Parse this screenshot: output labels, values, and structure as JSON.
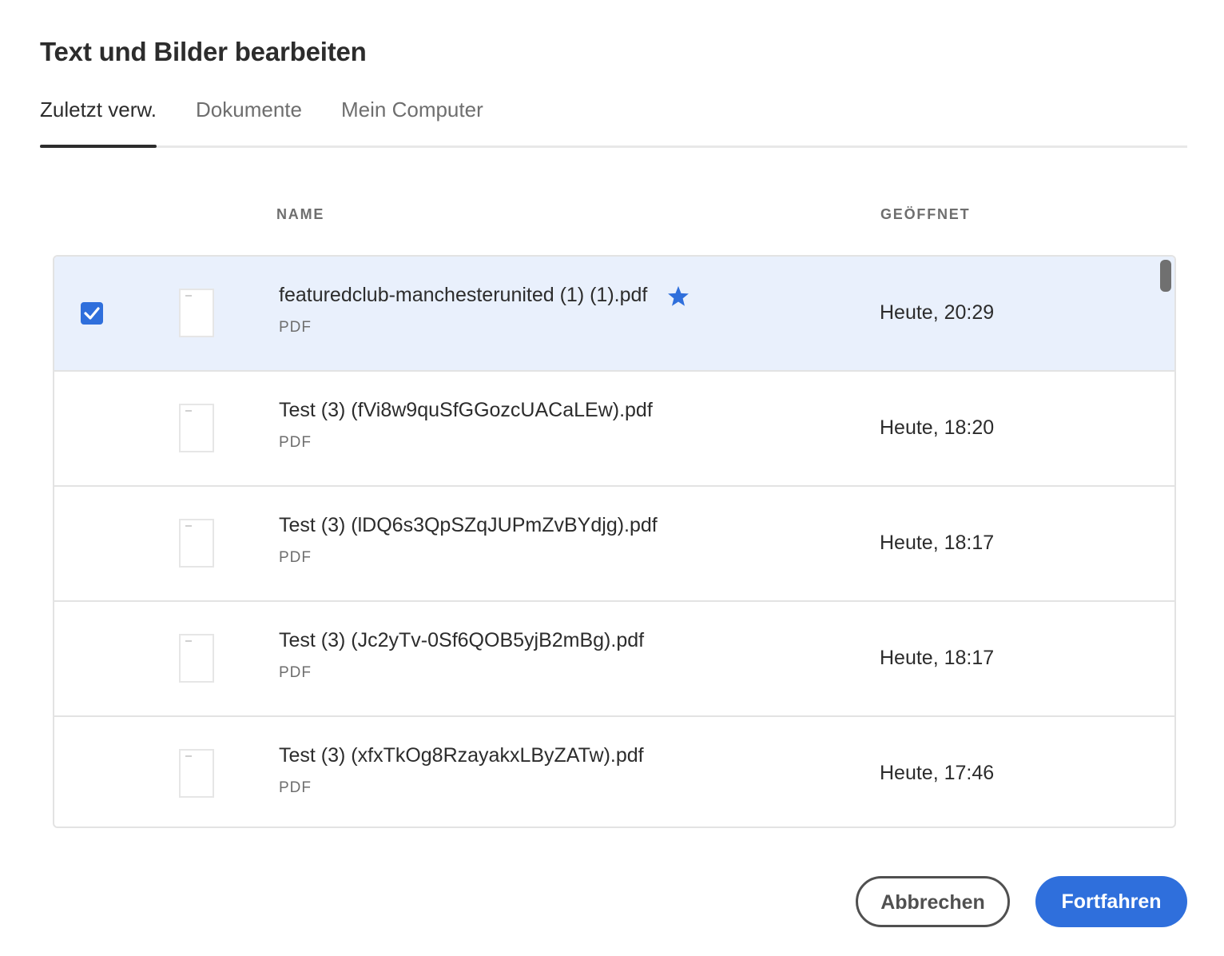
{
  "dialog": {
    "title": "Text und Bilder bearbeiten"
  },
  "tabs": [
    {
      "label": "Zuletzt verw.",
      "active": true
    },
    {
      "label": "Dokumente",
      "active": false
    },
    {
      "label": "Mein Computer",
      "active": false
    }
  ],
  "table": {
    "headers": {
      "name": "NAME",
      "opened": "GEÖFFNET"
    },
    "rows": [
      {
        "name": "featuredclub-manchesterunited (1) (1).pdf",
        "type": "PDF",
        "opened": "Heute, 20:29",
        "selected": true,
        "starred": true
      },
      {
        "name": "Test (3) (fVi8w9quSfGGozcUACaLEw).pdf",
        "type": "PDF",
        "opened": "Heute, 18:20",
        "selected": false,
        "starred": false
      },
      {
        "name": "Test (3) (lDQ6s3QpSZqJUPmZvBYdjg).pdf",
        "type": "PDF",
        "opened": "Heute, 18:17",
        "selected": false,
        "starred": false
      },
      {
        "name": "Test (3) (Jc2yTv-0Sf6QOB5yjB2mBg).pdf",
        "type": "PDF",
        "opened": "Heute, 18:17",
        "selected": false,
        "starred": false
      },
      {
        "name": "Test (3) (xfxTkOg8RzayakxLByZATw).pdf",
        "type": "PDF",
        "opened": "Heute, 17:46",
        "selected": false,
        "starred": false
      }
    ]
  },
  "buttons": {
    "cancel": "Abbrechen",
    "continue": "Fortfahren"
  },
  "colors": {
    "accent": "#2f6fdc",
    "selected_row": "#e9f0fc",
    "text": "#2c2c2c",
    "muted": "#6e6e6e"
  }
}
